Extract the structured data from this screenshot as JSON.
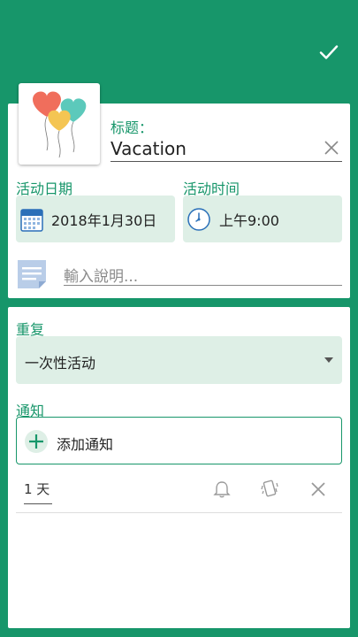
{
  "header": {
    "confirm_icon": "check-icon"
  },
  "event": {
    "image_icon": "heart-balloons-image",
    "title_label": "标题：",
    "title_value": "Vacation",
    "date_label": "活动日期",
    "date_value": "2018年1月30日",
    "time_label": "活动时间",
    "time_value": "上午9:00",
    "description_placeholder": "輸入說明..."
  },
  "repeat": {
    "label": "重复",
    "selected": "一次性活动"
  },
  "notifications": {
    "label": "通知",
    "add_label": "添加通知",
    "items": [
      {
        "offset": "1 天"
      }
    ]
  },
  "colors": {
    "primary": "#17966a",
    "chip_bg": "#deefe6"
  }
}
